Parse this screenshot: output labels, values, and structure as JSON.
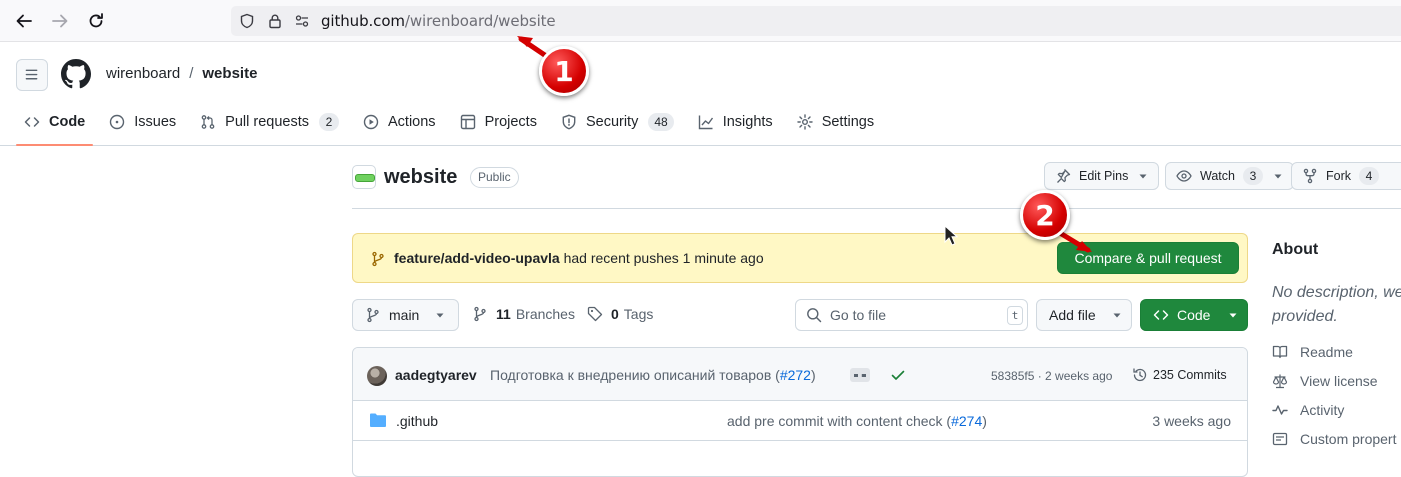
{
  "browser": {
    "url_host": "github.com",
    "url_path": "/wirenboard/website"
  },
  "header": {
    "owner": "wirenboard",
    "separator": "/",
    "repo": "website"
  },
  "tabs": [
    {
      "label": "Code",
      "icon": "code-icon",
      "active": true
    },
    {
      "label": "Issues",
      "icon": "issue-icon"
    },
    {
      "label": "Pull requests",
      "icon": "pull-request-icon",
      "count": "2"
    },
    {
      "label": "Actions",
      "icon": "play-icon"
    },
    {
      "label": "Projects",
      "icon": "table-icon"
    },
    {
      "label": "Security",
      "icon": "shield-icon",
      "count": "48"
    },
    {
      "label": "Insights",
      "icon": "graph-icon"
    },
    {
      "label": "Settings",
      "icon": "gear-icon"
    }
  ],
  "repo_header": {
    "title": "website",
    "visibility": "Public",
    "edit_pins_label": "Edit Pins",
    "watch_label": "Watch",
    "watch_count": "3",
    "fork_label": "Fork",
    "fork_count": "4"
  },
  "push_banner": {
    "branch": "feature/add-video-upavla",
    "message": "had recent pushes 1 minute ago",
    "button_label": "Compare & pull request"
  },
  "toolbar": {
    "branch": "main",
    "branches_count": "11",
    "branches_label": "Branches",
    "tags_count": "0",
    "tags_label": "Tags",
    "search_placeholder": "Go to file",
    "search_shortcut": "t",
    "add_file_label": "Add file",
    "code_label": "Code"
  },
  "latest_commit": {
    "author": "aadegtyarev",
    "message": "Подготовка к внедрению описаний товаров (",
    "pr": "#272",
    "message_end": ")",
    "meta": "58385f5 · 2 weeks ago",
    "commits_label": "235 Commits"
  },
  "files": [
    {
      "name": ".github",
      "commit_message": "add pre commit with content check (",
      "pr": "#274",
      "commit_end": ")",
      "date": "3 weeks ago"
    }
  ],
  "about": {
    "title": "About",
    "description": "No description, website, or topics provided.",
    "desc_line1": "No description, we",
    "desc_line2": "provided.",
    "items": [
      {
        "label": "Readme",
        "icon": "book-icon"
      },
      {
        "label": "View license",
        "icon": "law-icon"
      },
      {
        "label": "Activity",
        "icon": "pulse-icon"
      },
      {
        "label": "Custom propert",
        "icon": "note-icon"
      }
    ]
  },
  "annotations": {
    "first": "1",
    "second": "2"
  },
  "colors": {
    "accent_green": "#1f883d",
    "tab_underline": "#fd8c73",
    "banner_bg": "#fff8c5",
    "annotation_red": "#d40000",
    "link_blue": "#0969da"
  }
}
